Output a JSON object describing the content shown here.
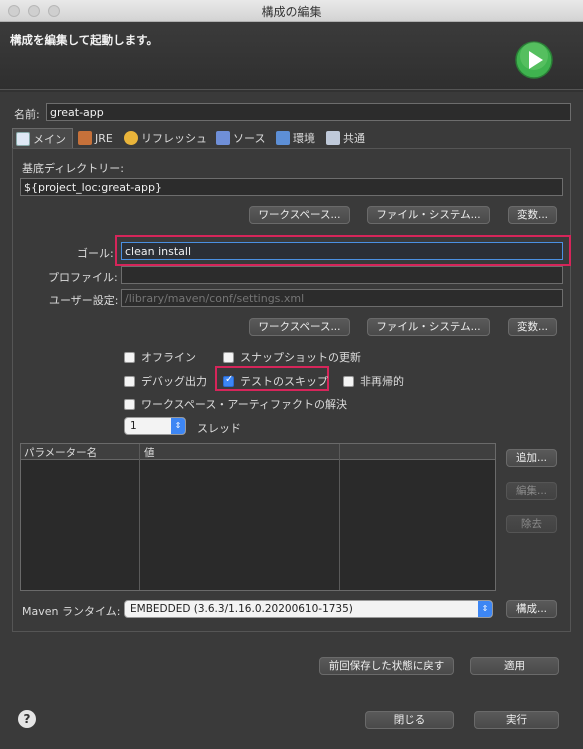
{
  "window": {
    "title": "構成の編集"
  },
  "banner": {
    "text": "構成を編集して起動します。"
  },
  "name": {
    "label": "名前:",
    "value": "great-app"
  },
  "tabs": [
    {
      "label": "メイン",
      "icon": "main-tab-icon"
    },
    {
      "label": "JRE",
      "icon": "jre-icon"
    },
    {
      "label": "リフレッシュ",
      "icon": "refresh-icon"
    },
    {
      "label": "ソース",
      "icon": "source-icon"
    },
    {
      "label": "環境",
      "icon": "environment-icon"
    },
    {
      "label": "共通",
      "icon": "common-icon"
    }
  ],
  "base_dir": {
    "label": "基底ディレクトリー:",
    "value": "${project_loc:great-app}"
  },
  "buttons_row1": {
    "workspace": "ワークスペース...",
    "filesystem": "ファイル・システム...",
    "variables": "変数..."
  },
  "goal": {
    "label": "ゴール:",
    "value": "clean install"
  },
  "profile": {
    "label": "プロファイル:",
    "value": ""
  },
  "user_settings": {
    "label": "ユーザー設定:",
    "placeholder": "/library/maven/conf/settings.xml"
  },
  "buttons_row2": {
    "workspace": "ワークスペース...",
    "filesystem": "ファイル・システム...",
    "variables": "変数..."
  },
  "options": {
    "offline": {
      "label": "オフライン",
      "checked": false
    },
    "update_snapshots": {
      "label": "スナップショットの更新",
      "checked": false
    },
    "debug": {
      "label": "デバッグ出力",
      "checked": false
    },
    "skip_tests": {
      "label": "テストのスキップ",
      "checked": true
    },
    "non_recursive": {
      "label": "非再帰的",
      "checked": false
    },
    "resolve_workspace": {
      "label": "ワークスペース・アーティファクトの解決",
      "checked": false
    }
  },
  "threads": {
    "value": "1",
    "label": "スレッド"
  },
  "params_table": {
    "col_name": "パラメーター名",
    "col_value": "値"
  },
  "param_buttons": {
    "add": "追加...",
    "edit": "編集...",
    "remove": "除去"
  },
  "runtime": {
    "label": "Maven ランタイム:",
    "value": "EMBEDDED (3.6.3/1.16.0.20200610-1735)",
    "configure": "構成..."
  },
  "footer": {
    "revert": "前回保存した状態に戻す",
    "apply": "適用",
    "close": "閉じる",
    "run": "実行",
    "help": "?"
  },
  "colors": {
    "highlight": "#d6255a",
    "accent": "#3d86f4",
    "run_green": "#3fb34f"
  }
}
